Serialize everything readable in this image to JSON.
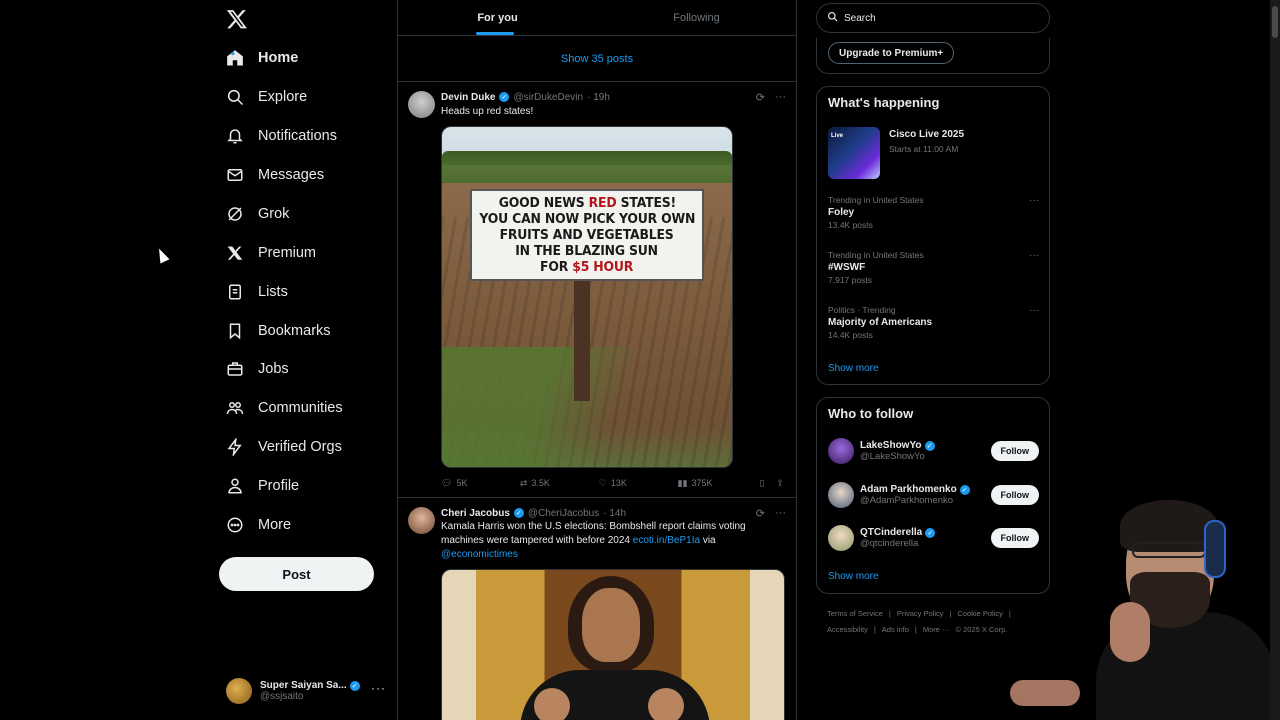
{
  "nav": {
    "items": [
      {
        "label": "Home",
        "icon": "home-icon",
        "top": 0
      },
      {
        "label": "Explore",
        "icon": "search-icon"
      },
      {
        "label": "Notifications",
        "icon": "bell-icon"
      },
      {
        "label": "Messages",
        "icon": "mail-icon"
      },
      {
        "label": "Grok",
        "icon": "grok-icon"
      },
      {
        "label": "Premium",
        "icon": "x-icon"
      },
      {
        "label": "Lists",
        "icon": "list-icon"
      },
      {
        "label": "Bookmarks",
        "icon": "bookmark-icon"
      },
      {
        "label": "Jobs",
        "icon": "briefcase-icon"
      },
      {
        "label": "Communities",
        "icon": "people-icon"
      },
      {
        "label": "Verified Orgs",
        "icon": "lightning-icon"
      },
      {
        "label": "Profile",
        "icon": "person-icon"
      },
      {
        "label": "More",
        "icon": "more-circle-icon"
      }
    ],
    "post_label": "Post",
    "account": {
      "name": "Super Saiyan Sa...",
      "handle": "@ssjsaito"
    }
  },
  "timeline": {
    "tabs": [
      "For you",
      "Following"
    ],
    "show_posts": "Show 35 posts",
    "tweets": [
      {
        "name": "Devin Duke",
        "handle": "@sirDukeDevin",
        "time": "· 19h",
        "text": "Heads up red states!",
        "sign_lines": [
          "GOOD NEWS ",
          "RED",
          " STATES!",
          "YOU CAN NOW PICK YOUR OWN",
          "FRUITS  AND VEGETABLES",
          "IN THE BLAZING SUN",
          "FOR ",
          "$5 HOUR"
        ],
        "replies": "5K",
        "retweets": "3.5K",
        "likes": "13K",
        "views": "375K"
      },
      {
        "name": "Cheri Jacobus",
        "handle": "@CheriJacobus",
        "time": "· 14h",
        "text_before": "Kamala Harris won the U.S elections: Bombshell report claims voting machines were tampered with before 2024 ",
        "link": "ecoti.in/BeP1Ia",
        "text_mid": " via",
        "mention": "@economictimes"
      }
    ]
  },
  "sidebar": {
    "search_placeholder": "Search",
    "premium_label": "Upgrade to Premium+",
    "whats_happening": {
      "title": "What's happening",
      "event": {
        "title": "Cisco Live 2025",
        "sub": "Starts at 11:00 AM",
        "badge": "Live"
      },
      "trends": [
        {
          "meta": "Trending in United States",
          "name": "Foley",
          "count": "13.4K posts"
        },
        {
          "meta": "Trending in United States",
          "name": "#WSWF",
          "count": "7,917 posts"
        },
        {
          "meta": "Politics · Trending",
          "name": "Majority of Americans",
          "count": "14.4K posts"
        }
      ],
      "show_more": "Show more"
    },
    "who_to_follow": {
      "title": "Who to follow",
      "users": [
        {
          "name": "LakeShowYo",
          "handle": "@LakeShowYo",
          "follow": "Follow"
        },
        {
          "name": "Adam Parkhomenko",
          "handle": "@AdamParkhomenko",
          "follow": "Follow"
        },
        {
          "name": "QTCinderella",
          "handle": "@qtcinderella",
          "follow": "Follow"
        }
      ],
      "show_more": "Show more"
    },
    "footer": [
      "Terms of Service",
      "|",
      "Privacy Policy",
      "|",
      "Cookie Policy",
      "|",
      "Accessibility",
      "|",
      "Ads info",
      "|",
      "More ···",
      "© 2025 X Corp."
    ]
  },
  "colors": {
    "accent": "#1d9bf0",
    "background": "#000000",
    "border": "#2f3336",
    "muted": "#71767b"
  }
}
